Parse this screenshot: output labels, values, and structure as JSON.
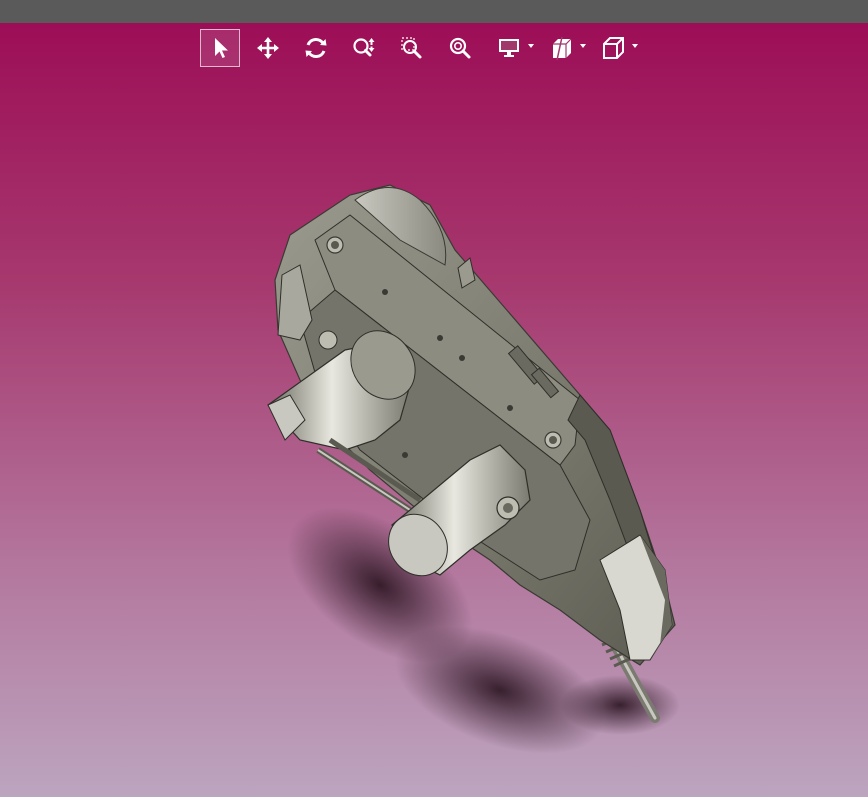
{
  "window": {
    "title": ""
  },
  "colors": {
    "topbar": "#5a5a5a",
    "background_top": "#9c0a55",
    "background_bottom": "#bca5bf",
    "toolbar_icon": "#ffffff",
    "model_body": "#8a8a7e"
  },
  "toolbar": {
    "items": [
      {
        "icon": "select-pointer-icon",
        "active": true
      },
      {
        "icon": "pan-move-icon",
        "active": false
      },
      {
        "icon": "rotate-icon",
        "active": false
      },
      {
        "icon": "zoom-in-out-icon",
        "active": false
      },
      {
        "icon": "zoom-to-area-icon",
        "active": false
      },
      {
        "icon": "zoom-to-fit-icon",
        "active": false
      },
      {
        "icon": "display-monitor-icon",
        "active": false,
        "has_dropdown": true
      },
      {
        "icon": "section-view-icon",
        "active": false,
        "has_dropdown": true
      },
      {
        "icon": "view-orientation-cube-icon",
        "active": false,
        "has_dropdown": true
      }
    ]
  },
  "viewport": {
    "model": "3d-cad-part-isometric"
  }
}
